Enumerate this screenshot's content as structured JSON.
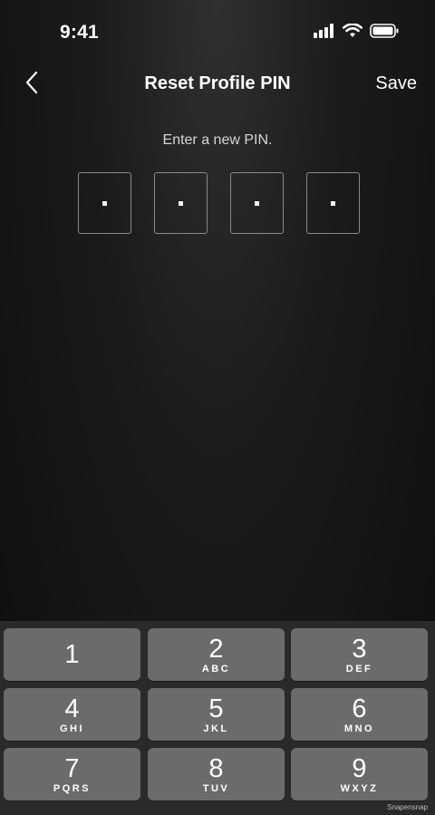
{
  "status_bar": {
    "time": "9:41",
    "icons": [
      "signal-icon",
      "wifi-icon",
      "battery-icon"
    ]
  },
  "header": {
    "title": "Reset Profile PIN",
    "back_icon": "chevron-left-icon",
    "save_label": "Save"
  },
  "pin": {
    "prompt": "Enter a new PIN.",
    "length": 4,
    "entered": 4
  },
  "keypad": {
    "keys": [
      {
        "digit": "1",
        "letters": ""
      },
      {
        "digit": "2",
        "letters": "ABC"
      },
      {
        "digit": "3",
        "letters": "DEF"
      },
      {
        "digit": "4",
        "letters": "GHI"
      },
      {
        "digit": "5",
        "letters": "JKL"
      },
      {
        "digit": "6",
        "letters": "MNO"
      },
      {
        "digit": "7",
        "letters": "PQRS"
      },
      {
        "digit": "8",
        "letters": "TUV"
      },
      {
        "digit": "9",
        "letters": "WXYZ"
      }
    ]
  },
  "watermark": "Snapensnap",
  "colors": {
    "key_background": "#6b6b6b",
    "keypad_background": "#2a2a2b",
    "pin_border": "#8a8a8a"
  }
}
